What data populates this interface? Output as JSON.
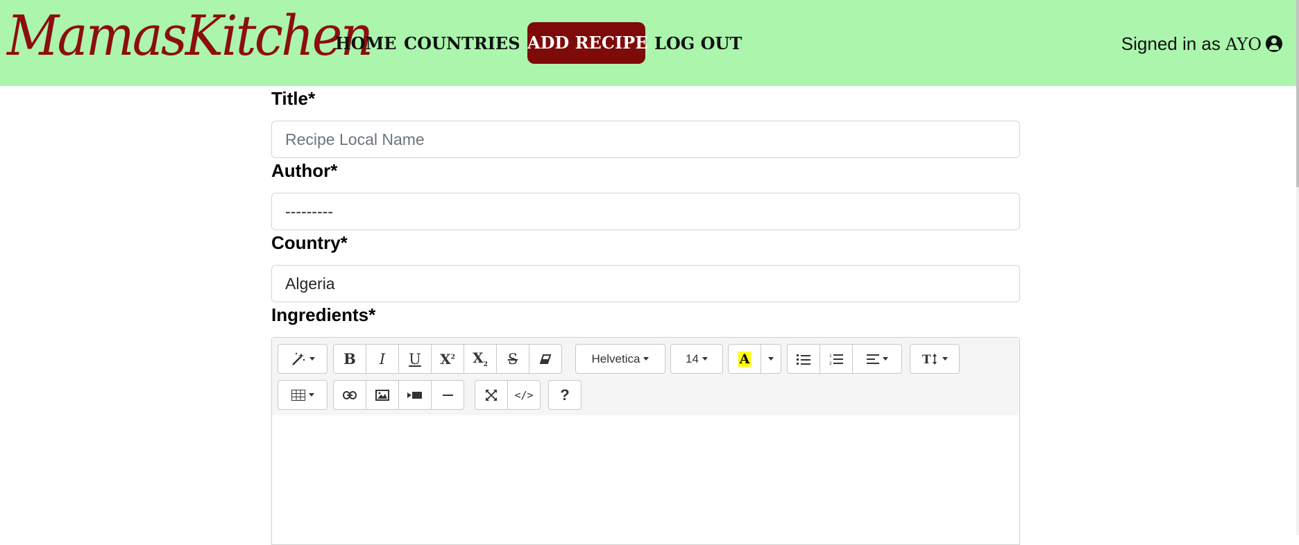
{
  "navbar": {
    "brand": "MamasKitchen",
    "items": [
      {
        "label": "HOME"
      },
      {
        "label": "COUNTRIES"
      },
      {
        "label": "ADD RECIPE"
      },
      {
        "label": "LOG OUT"
      }
    ],
    "signed_in_prefix": "Signed in as ",
    "username": "AYO",
    "user_icon": "user-circle-icon"
  },
  "colors": {
    "navbar_bg": "#abf5ac",
    "brand": "#8c0e0e",
    "accent_button": "#7e0a0a",
    "highlight": "#ffff00"
  },
  "form": {
    "title_label": "Title*",
    "title_placeholder": "Recipe Local Name",
    "title_value": "",
    "author_label": "Author*",
    "author_value": "---------",
    "country_label": "Country*",
    "country_value": "Algeria",
    "ingredients_label": "Ingredients*"
  },
  "editor": {
    "font_name": "Helvetica",
    "font_size": "14",
    "highlight_letter": "A",
    "help": "?",
    "codeview": "</>",
    "tools_row1": [
      "magic-wand",
      "bold",
      "italic",
      "underline",
      "superscript",
      "subscript",
      "strikethrough",
      "eraser",
      "font-name",
      "font-size",
      "text-color",
      "text-color-dropdown",
      "unordered-list",
      "ordered-list",
      "paragraph-align",
      "line-height"
    ],
    "tools_row2": [
      "table",
      "link",
      "picture",
      "video",
      "horizontal-rule",
      "fullscreen",
      "codeview",
      "help"
    ]
  }
}
